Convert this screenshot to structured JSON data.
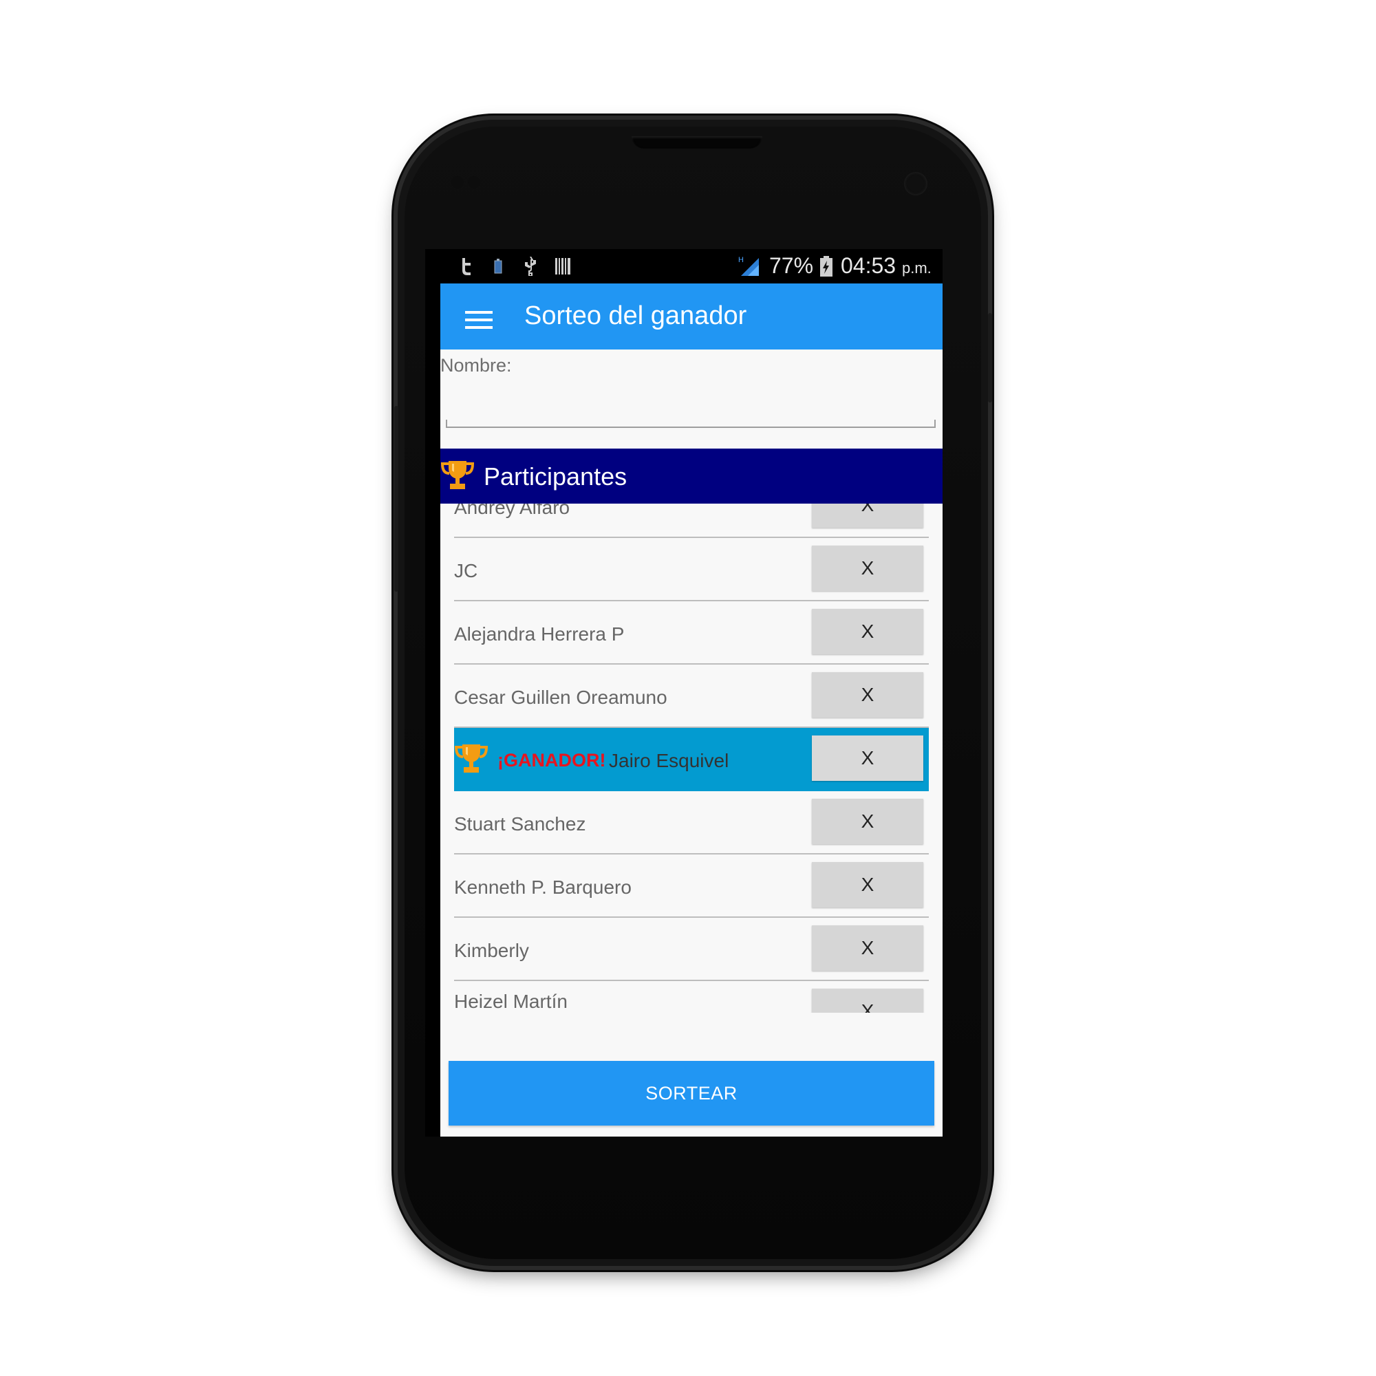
{
  "status_bar": {
    "battery_percent": "77%",
    "time": "04:53",
    "time_suffix": "p.m.",
    "network_type": "H",
    "icons": [
      "twitter-icon",
      "battery-saver-icon",
      "usb-icon",
      "barcode-icon",
      "signal-icon",
      "battery-charging-icon"
    ]
  },
  "toolbar": {
    "title": "Sorteo del ganador"
  },
  "form": {
    "name_label": "Nombre:",
    "name_value": "",
    "name_placeholder": ""
  },
  "section": {
    "title": "Participantes"
  },
  "participants": [
    {
      "name": "Andrey Alfaro",
      "delete_label": "X",
      "winner": false
    },
    {
      "name": "JC",
      "delete_label": "X",
      "winner": false
    },
    {
      "name": "Alejandra Herrera P",
      "delete_label": "X",
      "winner": false
    },
    {
      "name": "Cesar Guillen Oreamuno",
      "delete_label": "X",
      "winner": false
    },
    {
      "name": "Jairo Esquivel",
      "delete_label": "X",
      "winner": true,
      "winner_label": "¡GANADOR!"
    },
    {
      "name": "Stuart Sanchez",
      "delete_label": "X",
      "winner": false
    },
    {
      "name": "Kenneth P. Barquero",
      "delete_label": "X",
      "winner": false
    },
    {
      "name": "Kimberly",
      "delete_label": "X",
      "winner": false
    },
    {
      "name": "Heizel Martín",
      "delete_label": "X",
      "winner": false
    }
  ],
  "actions": {
    "draw_label": "SORTEAR"
  },
  "colors": {
    "toolbar": "#2196f3",
    "section_header": "#000080",
    "winner_row": "#039bd0",
    "winner_label": "#e8141f",
    "trophy": "#f39c12"
  }
}
